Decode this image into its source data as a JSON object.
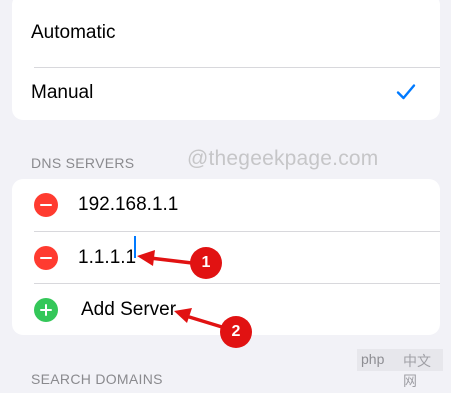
{
  "mode_options": [
    {
      "label": "Automatic",
      "selected": false
    },
    {
      "label": "Manual",
      "selected": true
    }
  ],
  "dns_section": {
    "header": "DNS SERVERS",
    "servers": [
      "192.168.1.1",
      "1.1.1.1"
    ],
    "add_label": "Add Server"
  },
  "watermark": "@thegeekpage.com",
  "annotations": {
    "badge1": "1",
    "badge2": "2"
  },
  "search_section": {
    "header": "SEARCH DOMAINS"
  },
  "corner_logo": {
    "text": "php",
    "cn": "中文网"
  },
  "colors": {
    "accent": "#007aff",
    "remove": "#ff3b30",
    "add": "#34c759",
    "annotation": "#e11212"
  }
}
